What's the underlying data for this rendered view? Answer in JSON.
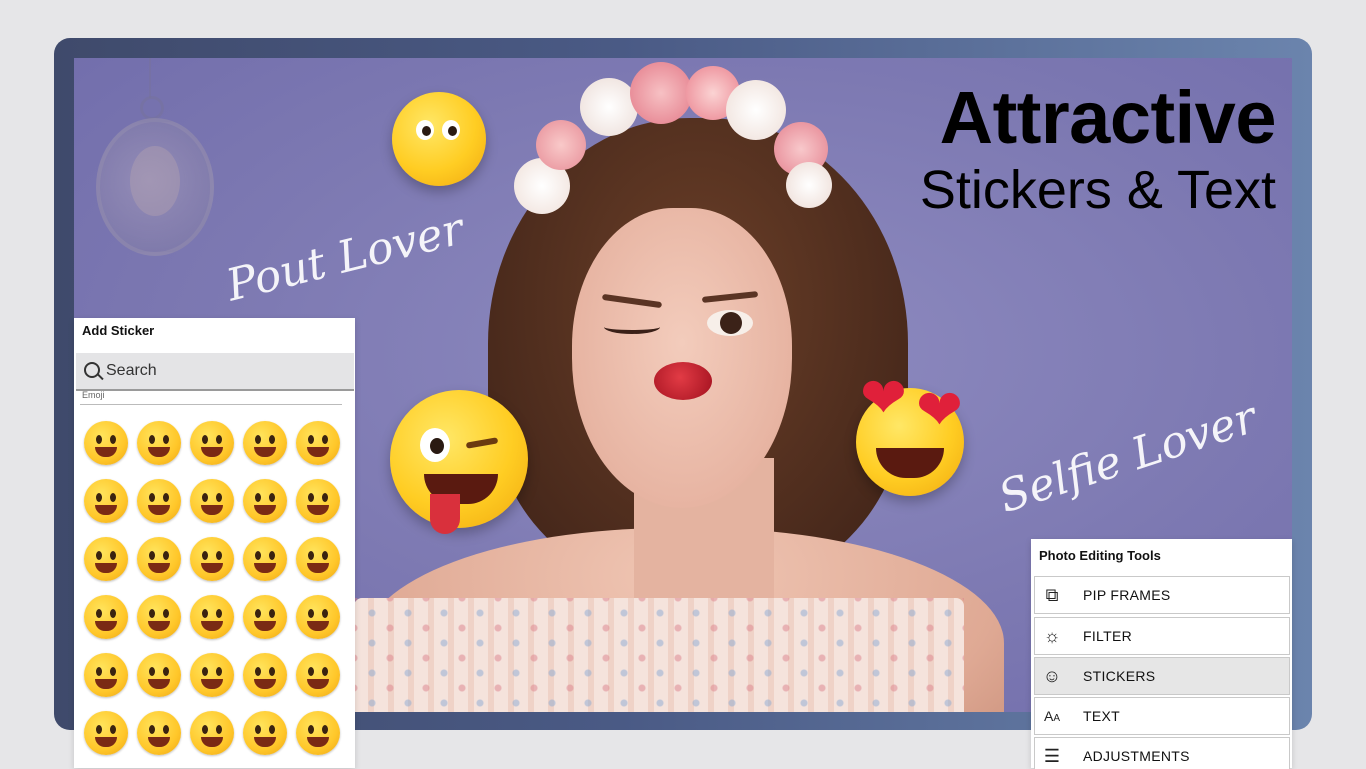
{
  "headline": {
    "line1": "Attractive",
    "line2": "Stickers & Text"
  },
  "script_texts": {
    "pout": "Pout Lover",
    "selfie": "Selfie Lover"
  },
  "add_sticker_panel": {
    "title": "Add Sticker",
    "search_placeholder": "Search",
    "section_label": "Emoji",
    "rows": 6,
    "columns": 5
  },
  "tools_panel": {
    "title": "Photo Editing Tools",
    "items": [
      {
        "label": "PIP FRAMES",
        "icon": "pip-frames-icon",
        "active": false
      },
      {
        "label": "FILTER",
        "icon": "filter-icon",
        "active": false
      },
      {
        "label": "STICKERS",
        "icon": "smiley-icon",
        "active": true
      },
      {
        "label": "TEXT",
        "icon": "text-icon",
        "active": false
      },
      {
        "label": "ADJUSTMENTS",
        "icon": "sliders-icon",
        "active": false
      }
    ]
  },
  "colors": {
    "canvas_background": "#7d79b2",
    "emoji_yellow": "#ffcd23",
    "active_tool_background": "#e6e6e6"
  }
}
